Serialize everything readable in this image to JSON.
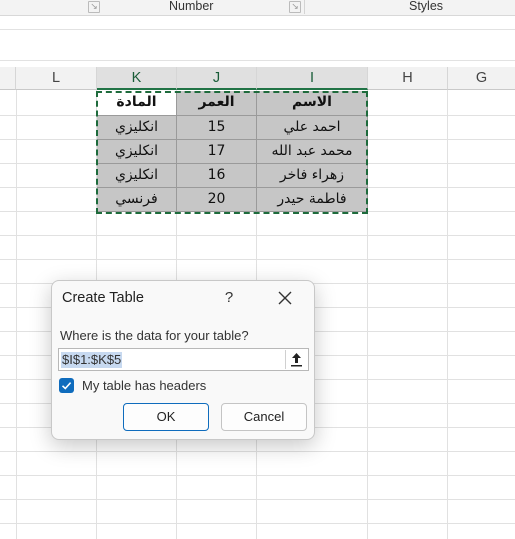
{
  "ribbon": {
    "groups": [
      "Number",
      "Styles"
    ],
    "launcher_icon": "dialog-launcher-icon"
  },
  "columns": [
    "L",
    "K",
    "J",
    "I",
    "H",
    "G"
  ],
  "table": {
    "headers": [
      "المادة",
      "العمر",
      "الاسم"
    ],
    "rows": [
      [
        "انكليزي",
        "15",
        "احمد علي"
      ],
      [
        "انكليزي",
        "17",
        "محمد عبد الله"
      ],
      [
        "انكليزي",
        "16",
        "زهراء فاخر"
      ],
      [
        "فرنسي",
        "20",
        "فاطمة حيدر"
      ]
    ]
  },
  "dialog": {
    "title": "Create Table",
    "help": "?",
    "prompt": "Where is the data for your table?",
    "range_value": "$I$1:$K$5",
    "checkbox_label": "My table has headers",
    "checkbox_checked": true,
    "ok_label": "OK",
    "cancel_label": "Cancel"
  },
  "colors": {
    "accent": "#0f6cbd",
    "excel_green": "#217346",
    "selection_gray": "#c6c6c6"
  }
}
